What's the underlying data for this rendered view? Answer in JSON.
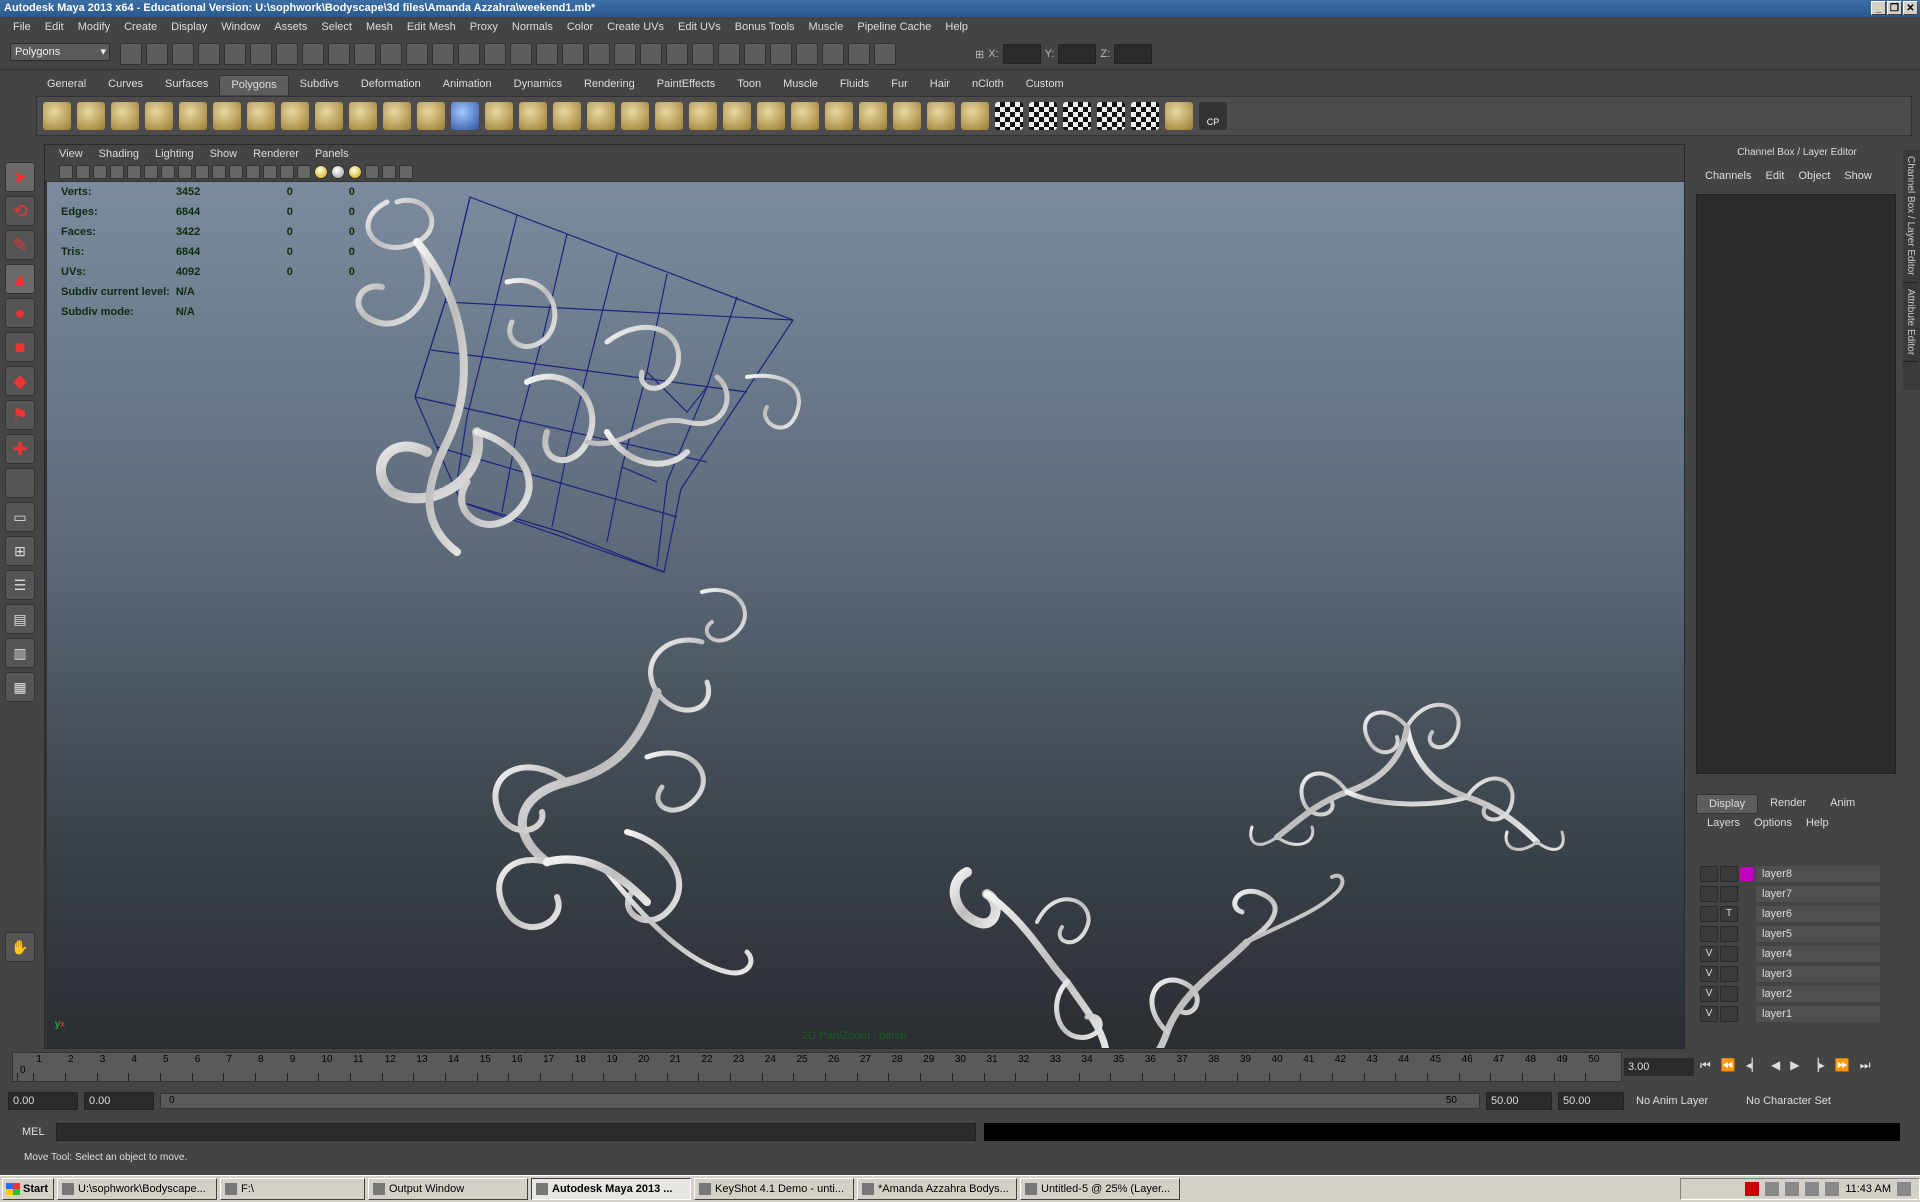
{
  "window": {
    "title": "Autodesk Maya 2013 x64 - Educational Version: U:\\sophwork\\Bodyscape\\3d files\\Amanda Azzahra\\weekend1.mb*"
  },
  "menubar": [
    "File",
    "Edit",
    "Modify",
    "Create",
    "Display",
    "Window",
    "Assets",
    "Select",
    "Mesh",
    "Edit Mesh",
    "Proxy",
    "Normals",
    "Color",
    "Create UVs",
    "Edit UVs",
    "Bonus Tools",
    "Muscle",
    "Pipeline Cache",
    "Help"
  ],
  "statusline": {
    "mode": "Polygons",
    "x_label": "X:",
    "y_label": "Y:",
    "z_label": "Z:"
  },
  "shelf": {
    "tabs": [
      "General",
      "Curves",
      "Surfaces",
      "Polygons",
      "Subdivs",
      "Deformation",
      "Animation",
      "Dynamics",
      "Rendering",
      "PaintEffects",
      "Toon",
      "Muscle",
      "Fluids",
      "Fur",
      "Hair",
      "nCloth",
      "Custom"
    ],
    "active_tab": "Polygons",
    "last_icon_label": "CP"
  },
  "panel": {
    "menu": [
      "View",
      "Shading",
      "Lighting",
      "Show",
      "Renderer",
      "Panels"
    ],
    "camera_label": "2D Pan/Zoom : persp"
  },
  "hud": {
    "rows": [
      {
        "label": "Verts:",
        "v1": "3452",
        "v2": "0",
        "v3": "0"
      },
      {
        "label": "Edges:",
        "v1": "6844",
        "v2": "0",
        "v3": "0"
      },
      {
        "label": "Faces:",
        "v1": "3422",
        "v2": "0",
        "v3": "0"
      },
      {
        "label": "Tris:",
        "v1": "6844",
        "v2": "0",
        "v3": "0"
      },
      {
        "label": "UVs:",
        "v1": "4092",
        "v2": "0",
        "v3": "0"
      }
    ],
    "subdiv_level_label": "Subdiv current level:",
    "subdiv_level_value": "N/A",
    "subdiv_mode_label": "Subdiv mode:",
    "subdiv_mode_value": "N/A"
  },
  "channel_box": {
    "title": "Channel Box / Layer Editor",
    "menu": [
      "Channels",
      "Edit",
      "Object",
      "Show"
    ]
  },
  "side_tabs": [
    "Channel Box / Layer Editor",
    "Attribute Editor"
  ],
  "layer_editor": {
    "tabs": [
      "Display",
      "Render",
      "Anim"
    ],
    "active_tab": "Display",
    "menu": [
      "Layers",
      "Options",
      "Help"
    ],
    "layers": [
      {
        "name": "layer8",
        "vis": "",
        "type": "",
        "color": "#c000c0"
      },
      {
        "name": "layer7",
        "vis": "",
        "type": "",
        "color": ""
      },
      {
        "name": "layer6",
        "vis": "",
        "type": "T",
        "color": ""
      },
      {
        "name": "layer5",
        "vis": "",
        "type": "",
        "color": ""
      },
      {
        "name": "layer4",
        "vis": "V",
        "type": "",
        "color": ""
      },
      {
        "name": "layer3",
        "vis": "V",
        "type": "",
        "color": ""
      },
      {
        "name": "layer2",
        "vis": "V",
        "type": "",
        "color": ""
      },
      {
        "name": "layer1",
        "vis": "V",
        "type": "",
        "color": ""
      }
    ]
  },
  "timeline": {
    "ticks": [
      "1",
      "2",
      "3",
      "4",
      "5",
      "6",
      "7",
      "8",
      "9",
      "10",
      "11",
      "12",
      "13",
      "14",
      "15",
      "16",
      "17",
      "18",
      "19",
      "20",
      "21",
      "22",
      "23",
      "24",
      "25",
      "26",
      "27",
      "28",
      "29",
      "30",
      "31",
      "32",
      "33",
      "34",
      "35",
      "36",
      "37",
      "38",
      "39",
      "40",
      "41",
      "42",
      "43",
      "44",
      "45",
      "46",
      "47",
      "48",
      "49",
      "50"
    ],
    "current_frame": "3.00",
    "start_marker": "0"
  },
  "range": {
    "start": "0.00",
    "playback_start": "0.00",
    "slider_left": "0",
    "slider_right": "50",
    "playback_end": "50.00",
    "end": "50.00",
    "anim_layer": "No Anim Layer",
    "char_set": "No Character Set"
  },
  "commandline": {
    "label": "MEL"
  },
  "helpline": "Move Tool: Select an object to move.",
  "taskbar": {
    "start": "Start",
    "items": [
      {
        "label": "U:\\sophwork\\Bodyscape...",
        "active": false
      },
      {
        "label": "F:\\",
        "active": false
      },
      {
        "label": "Output Window",
        "active": false
      },
      {
        "label": "Autodesk Maya 2013 ...",
        "active": true
      },
      {
        "label": "KeyShot 4.1 Demo - unti...",
        "active": false
      },
      {
        "label": "*Amanda Azzahra Bodys...",
        "active": false
      },
      {
        "label": "Untitled-5 @ 25% (Layer...",
        "active": false
      }
    ],
    "clock": "11:43 AM"
  },
  "colors": {
    "accent": "#c000c0",
    "wireframe": "#1a237e"
  }
}
